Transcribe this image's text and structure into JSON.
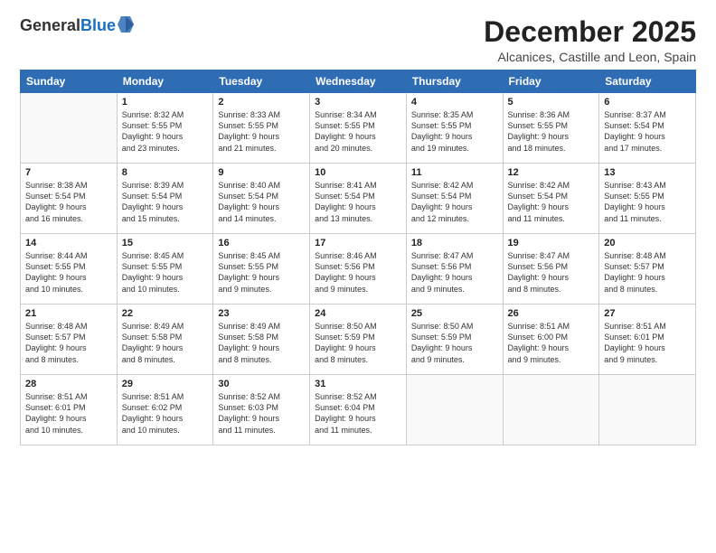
{
  "logo": {
    "general": "General",
    "blue": "Blue"
  },
  "header": {
    "month": "December 2025",
    "location": "Alcanices, Castille and Leon, Spain"
  },
  "weekdays": [
    "Sunday",
    "Monday",
    "Tuesday",
    "Wednesday",
    "Thursday",
    "Friday",
    "Saturday"
  ],
  "weeks": [
    [
      {
        "day": "",
        "info": ""
      },
      {
        "day": "1",
        "info": "Sunrise: 8:32 AM\nSunset: 5:55 PM\nDaylight: 9 hours\nand 23 minutes."
      },
      {
        "day": "2",
        "info": "Sunrise: 8:33 AM\nSunset: 5:55 PM\nDaylight: 9 hours\nand 21 minutes."
      },
      {
        "day": "3",
        "info": "Sunrise: 8:34 AM\nSunset: 5:55 PM\nDaylight: 9 hours\nand 20 minutes."
      },
      {
        "day": "4",
        "info": "Sunrise: 8:35 AM\nSunset: 5:55 PM\nDaylight: 9 hours\nand 19 minutes."
      },
      {
        "day": "5",
        "info": "Sunrise: 8:36 AM\nSunset: 5:55 PM\nDaylight: 9 hours\nand 18 minutes."
      },
      {
        "day": "6",
        "info": "Sunrise: 8:37 AM\nSunset: 5:54 PM\nDaylight: 9 hours\nand 17 minutes."
      }
    ],
    [
      {
        "day": "7",
        "info": "Sunrise: 8:38 AM\nSunset: 5:54 PM\nDaylight: 9 hours\nand 16 minutes."
      },
      {
        "day": "8",
        "info": "Sunrise: 8:39 AM\nSunset: 5:54 PM\nDaylight: 9 hours\nand 15 minutes."
      },
      {
        "day": "9",
        "info": "Sunrise: 8:40 AM\nSunset: 5:54 PM\nDaylight: 9 hours\nand 14 minutes."
      },
      {
        "day": "10",
        "info": "Sunrise: 8:41 AM\nSunset: 5:54 PM\nDaylight: 9 hours\nand 13 minutes."
      },
      {
        "day": "11",
        "info": "Sunrise: 8:42 AM\nSunset: 5:54 PM\nDaylight: 9 hours\nand 12 minutes."
      },
      {
        "day": "12",
        "info": "Sunrise: 8:42 AM\nSunset: 5:54 PM\nDaylight: 9 hours\nand 11 minutes."
      },
      {
        "day": "13",
        "info": "Sunrise: 8:43 AM\nSunset: 5:55 PM\nDaylight: 9 hours\nand 11 minutes."
      }
    ],
    [
      {
        "day": "14",
        "info": "Sunrise: 8:44 AM\nSunset: 5:55 PM\nDaylight: 9 hours\nand 10 minutes."
      },
      {
        "day": "15",
        "info": "Sunrise: 8:45 AM\nSunset: 5:55 PM\nDaylight: 9 hours\nand 10 minutes."
      },
      {
        "day": "16",
        "info": "Sunrise: 8:45 AM\nSunset: 5:55 PM\nDaylight: 9 hours\nand 9 minutes."
      },
      {
        "day": "17",
        "info": "Sunrise: 8:46 AM\nSunset: 5:56 PM\nDaylight: 9 hours\nand 9 minutes."
      },
      {
        "day": "18",
        "info": "Sunrise: 8:47 AM\nSunset: 5:56 PM\nDaylight: 9 hours\nand 9 minutes."
      },
      {
        "day": "19",
        "info": "Sunrise: 8:47 AM\nSunset: 5:56 PM\nDaylight: 9 hours\nand 8 minutes."
      },
      {
        "day": "20",
        "info": "Sunrise: 8:48 AM\nSunset: 5:57 PM\nDaylight: 9 hours\nand 8 minutes."
      }
    ],
    [
      {
        "day": "21",
        "info": "Sunrise: 8:48 AM\nSunset: 5:57 PM\nDaylight: 9 hours\nand 8 minutes."
      },
      {
        "day": "22",
        "info": "Sunrise: 8:49 AM\nSunset: 5:58 PM\nDaylight: 9 hours\nand 8 minutes."
      },
      {
        "day": "23",
        "info": "Sunrise: 8:49 AM\nSunset: 5:58 PM\nDaylight: 9 hours\nand 8 minutes."
      },
      {
        "day": "24",
        "info": "Sunrise: 8:50 AM\nSunset: 5:59 PM\nDaylight: 9 hours\nand 8 minutes."
      },
      {
        "day": "25",
        "info": "Sunrise: 8:50 AM\nSunset: 5:59 PM\nDaylight: 9 hours\nand 9 minutes."
      },
      {
        "day": "26",
        "info": "Sunrise: 8:51 AM\nSunset: 6:00 PM\nDaylight: 9 hours\nand 9 minutes."
      },
      {
        "day": "27",
        "info": "Sunrise: 8:51 AM\nSunset: 6:01 PM\nDaylight: 9 hours\nand 9 minutes."
      }
    ],
    [
      {
        "day": "28",
        "info": "Sunrise: 8:51 AM\nSunset: 6:01 PM\nDaylight: 9 hours\nand 10 minutes."
      },
      {
        "day": "29",
        "info": "Sunrise: 8:51 AM\nSunset: 6:02 PM\nDaylight: 9 hours\nand 10 minutes."
      },
      {
        "day": "30",
        "info": "Sunrise: 8:52 AM\nSunset: 6:03 PM\nDaylight: 9 hours\nand 11 minutes."
      },
      {
        "day": "31",
        "info": "Sunrise: 8:52 AM\nSunset: 6:04 PM\nDaylight: 9 hours\nand 11 minutes."
      },
      {
        "day": "",
        "info": ""
      },
      {
        "day": "",
        "info": ""
      },
      {
        "day": "",
        "info": ""
      }
    ]
  ]
}
